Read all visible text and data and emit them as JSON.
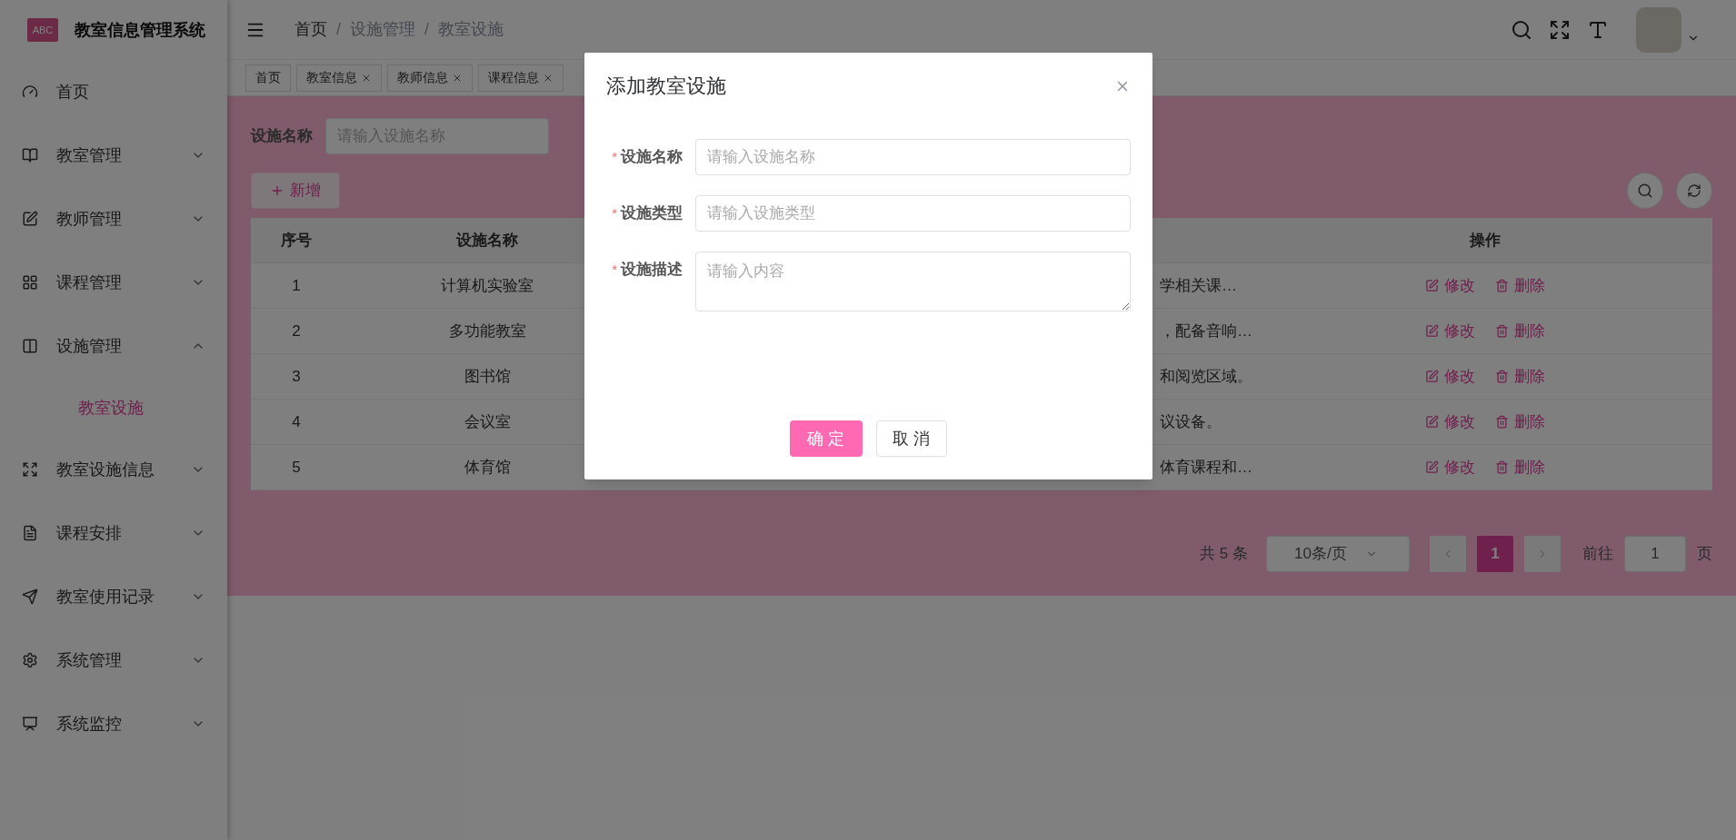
{
  "sidebar": {
    "logo_text": "ABC",
    "title": "教室信息管理系统",
    "items": [
      {
        "label": "首页",
        "kind": "link",
        "selected": false
      },
      {
        "label": "教室管理",
        "kind": "submenu",
        "expanded": false,
        "selected": false
      },
      {
        "label": "教师管理",
        "kind": "submenu",
        "expanded": false,
        "selected": false
      },
      {
        "label": "课程管理",
        "kind": "submenu",
        "expanded": false,
        "selected": false
      },
      {
        "label": "设施管理",
        "kind": "submenu",
        "expanded": true,
        "selected": false,
        "children": [
          {
            "label": "教室设施",
            "selected": true
          }
        ]
      },
      {
        "label": "教室设施信息",
        "kind": "submenu",
        "expanded": false,
        "selected": false
      },
      {
        "label": "课程安排",
        "kind": "submenu",
        "expanded": false,
        "selected": false
      },
      {
        "label": "教室使用记录",
        "kind": "submenu",
        "expanded": false,
        "selected": false
      },
      {
        "label": "系统管理",
        "kind": "submenu",
        "expanded": false,
        "selected": false
      },
      {
        "label": "系统监控",
        "kind": "submenu",
        "expanded": false,
        "selected": false
      }
    ]
  },
  "breadcrumb": [
    {
      "label": "首页"
    },
    {
      "separator": "/",
      "label": "设施管理"
    },
    {
      "separator": "/",
      "label": "教室设施"
    }
  ],
  "tabs": [
    {
      "label": "首页",
      "closable": false
    },
    {
      "label": "教室信息",
      "closable": true
    },
    {
      "label": "教师信息",
      "closable": true
    },
    {
      "label": "课程信息",
      "closable": true
    }
  ],
  "search": {
    "label": "设施名称",
    "placeholder": "请输入设施名称"
  },
  "add_button": "新增",
  "table": {
    "columns": [
      "序号",
      "设施名称",
      "操作"
    ],
    "rows": [
      {
        "index": "1",
        "name": "计算机实验室",
        "column_3": "学相关课…",
        "actions": [
          "修改",
          "删除"
        ]
      },
      {
        "index": "2",
        "name": "多功能教室",
        "column_3": "，配备音响…",
        "actions": [
          "修改",
          "删除"
        ]
      },
      {
        "index": "3",
        "name": "图书馆",
        "column_3": "和阅览区域。",
        "actions": [
          "修改",
          "删除"
        ]
      },
      {
        "index": "4",
        "name": "会议室",
        "column_3": "议设备。",
        "actions": [
          "修改",
          "删除"
        ]
      },
      {
        "index": "5",
        "name": "体育馆",
        "column_3": "体育课程和…",
        "actions": [
          "修改",
          "删除"
        ]
      }
    ]
  },
  "pagination": {
    "total": "共 5 条",
    "page_size": "10条/页",
    "pages": [
      {
        "label": "1",
        "selected": true
      }
    ],
    "goto_label": "前往",
    "goto_value": "1",
    "goto_suffix": "页"
  },
  "dialog": {
    "title": "添加教室设施",
    "fields": [
      {
        "label": "设施名称",
        "required_mark": "*",
        "kind": "input",
        "placeholder": "请输入设施名称"
      },
      {
        "label": "设施类型",
        "required_mark": "*",
        "kind": "input",
        "placeholder": "请输入设施类型"
      },
      {
        "label": "设施描述",
        "required_mark": "*",
        "kind": "textarea",
        "placeholder": "请输入内容"
      }
    ],
    "confirm": "确 定",
    "cancel": "取 消"
  }
}
